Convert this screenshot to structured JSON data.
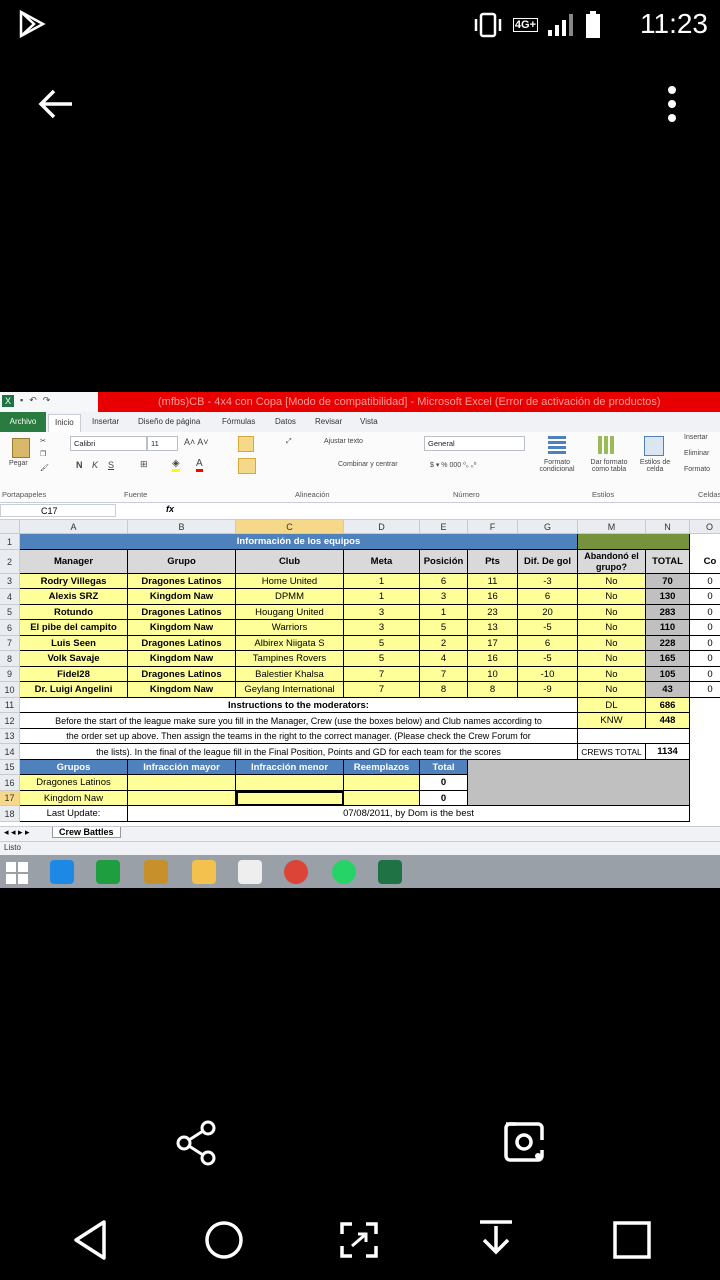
{
  "status_bar": {
    "time": "11:23",
    "network": "4G+"
  },
  "excel": {
    "window_title": "(mfbs)CB - 4x4 con Copa  [Modo de compatibilidad]  -  Microsoft Excel (Error de activación de productos)",
    "tabs": [
      "Archivo",
      "Inicio",
      "Insertar",
      "Diseño de página",
      "Fórmulas",
      "Datos",
      "Revisar",
      "Vista"
    ],
    "ribbon": {
      "paste": "Pegar",
      "font_name": "Calibri",
      "font_size": "11",
      "wrap_text": "Ajustar texto",
      "merge_center": "Combinar y centrar",
      "number_format": "General",
      "conditional_format": "Formato condicional",
      "table_format": "Dar formato como tabla",
      "cell_styles": "Estilos de celda",
      "insert": "Insertar",
      "delete": "Eliminar",
      "format": "Formato",
      "groups": [
        "Portapapeles",
        "Fuente",
        "Alineación",
        "Número",
        "Estilos",
        "Celdas"
      ]
    },
    "name_box": "C17",
    "fx": "fx",
    "columns": [
      "A",
      "B",
      "C",
      "D",
      "E",
      "F",
      "G",
      "M",
      "N",
      "O"
    ],
    "rows": [
      "1",
      "2",
      "3",
      "4",
      "5",
      "6",
      "7",
      "8",
      "9",
      "10",
      "11",
      "12",
      "13",
      "14",
      "15",
      "16",
      "17",
      "18"
    ],
    "title": "Información de los equipos",
    "headers": [
      "Manager",
      "Grupo",
      "Club",
      "Meta",
      "Posición",
      "Pts",
      "Dif. De gol",
      "Abandonó el grupo?",
      "TOTAL",
      "Co"
    ],
    "teams": [
      [
        "Rodry Villegas",
        "Dragones Latinos",
        "Home United",
        "1",
        "6",
        "11",
        "-3",
        "No",
        "70",
        "0"
      ],
      [
        "Alexis SRZ",
        "Kingdom Naw",
        "DPMM",
        "1",
        "3",
        "16",
        "6",
        "No",
        "130",
        "0"
      ],
      [
        "Rotundo",
        "Dragones Latinos",
        "Hougang United",
        "3",
        "1",
        "23",
        "20",
        "No",
        "283",
        "0"
      ],
      [
        "El pibe del campito",
        "Kingdom Naw",
        "Warriors",
        "3",
        "5",
        "13",
        "-5",
        "No",
        "110",
        "0"
      ],
      [
        "Luis Seen",
        "Dragones Latinos",
        "Albirex Niigata S",
        "5",
        "2",
        "17",
        "6",
        "No",
        "228",
        "0"
      ],
      [
        "Volk Savaje",
        "Kingdom Naw",
        "Tampines Rovers",
        "5",
        "4",
        "16",
        "-5",
        "No",
        "165",
        "0"
      ],
      [
        "Fidel28",
        "Dragones Latinos",
        "Balestier Khalsa",
        "7",
        "7",
        "10",
        "-10",
        "No",
        "105",
        "0"
      ],
      [
        "Dr. Luigi Angelini",
        "Kingdom Naw",
        "Geylang International",
        "7",
        "8",
        "8",
        "-9",
        "No",
        "43",
        "0"
      ]
    ],
    "instructions_title": "Instructions to the moderators:",
    "instructions_line1": "Before the start of the league make sure you fill in the Manager, Crew (use the boxes below) and Club names according to",
    "instructions_line2": "the order set up above. Then assign the teams in the right to the correct manager. (Please check the Crew Forum for",
    "instructions_line3": "the lists). In the final of the league fill in the Final Position, Points and GD for each team for the scores",
    "crew_totals": [
      {
        "label": "DL",
        "value": "686"
      },
      {
        "label": "KNW",
        "value": "448"
      },
      {
        "label": "CREWS TOTAL",
        "value": "1134"
      }
    ],
    "groups_headers": [
      "Grupos",
      "Infracción mayor",
      "Infracción menor",
      "Reemplazos",
      "Total"
    ],
    "groups_rows": [
      [
        "Dragones Latinos",
        "",
        "",
        "",
        "0"
      ],
      [
        "Kingdom Naw",
        "",
        "",
        "",
        "0"
      ]
    ],
    "last_update_label": "Last Update:",
    "last_update_value": "07/08/2011, by Dom is the best",
    "sheet_tab": "Crew Battles",
    "status": "Listo"
  }
}
